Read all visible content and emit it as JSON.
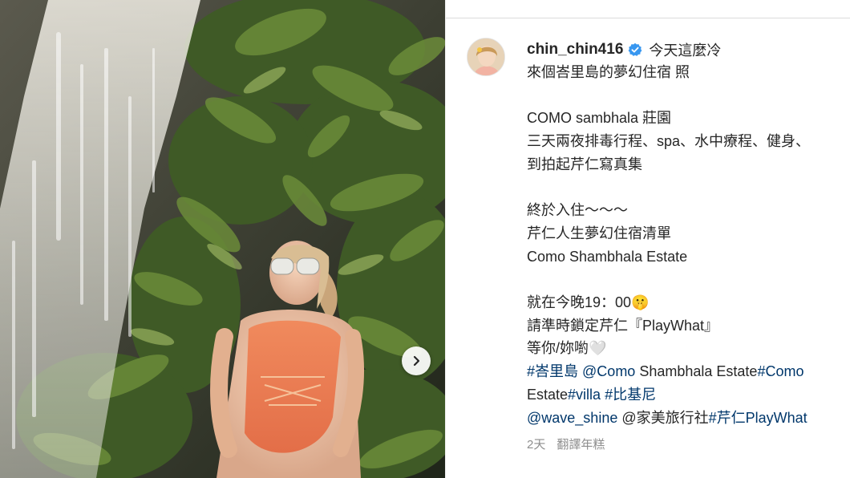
{
  "post": {
    "username": "chin_chin416",
    "caption_lines": {
      "first": "今天這麼冷",
      "l2": "來個峇里島的夢幻住宿 照",
      "l4": "COMO sambhala 莊園",
      "l5": "三天兩夜排毒行程、spa、水中療程、健身、",
      "l6": "到拍起芹仁寫真集",
      "l8": "終於入住～～～",
      "l9": "芹仁人生夢幻住宿清單",
      "l10": "Como Shambhala Estate",
      "l12": "就在今晚19：00🤫",
      "l13": "請準時鎖定芹仁『PlayWhat』",
      "l14": "等你/妳喲🤍"
    },
    "tags": {
      "t1": "#峇里島",
      "t2": "@Como",
      "t2b": " Shambhala Estate",
      "t3": "#Como",
      "t4": "Estate",
      "t5": "#villa",
      "t6": "#比基尼",
      "t7": "@wave_shine",
      "t8": " @家美旅行社",
      "t9": "#芹仁PlayWhat"
    },
    "time_ago": "2天",
    "translate_label": "翻譯年糕"
  },
  "colors": {
    "text": "#262626",
    "link": "#00376b",
    "meta": "#8e8e8e",
    "verified": "#3897f0"
  },
  "icons": {
    "verified": "verified-badge-icon",
    "next": "chevron-right-icon"
  }
}
